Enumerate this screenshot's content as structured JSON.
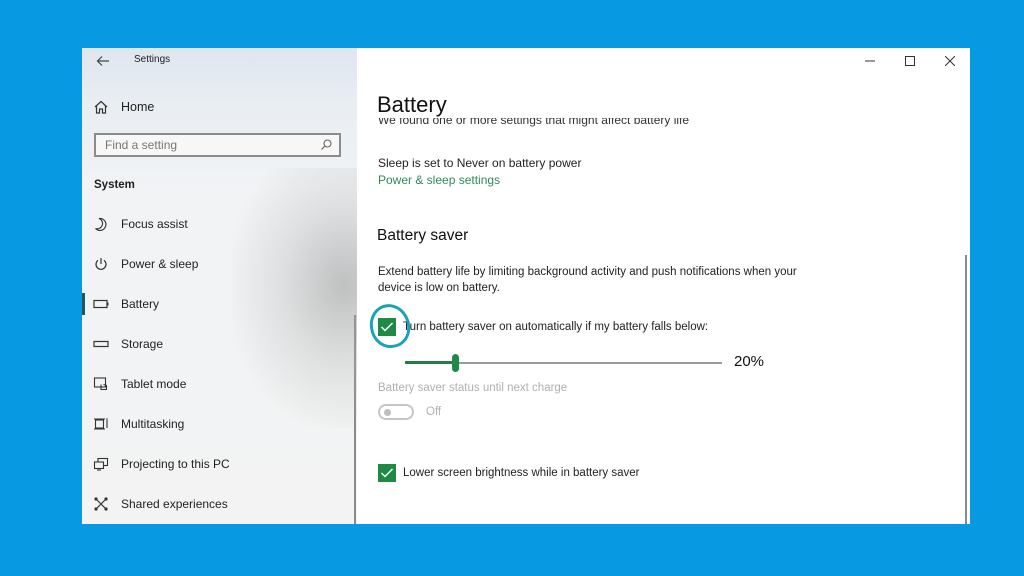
{
  "window": {
    "title": "Settings",
    "controls": {
      "minimize": "minimize",
      "maximize": "maximize",
      "close": "close"
    }
  },
  "sidebar": {
    "home_label": "Home",
    "search_placeholder": "Find a setting",
    "section_title": "System",
    "items": [
      {
        "label": "Focus assist",
        "icon": "moon-icon",
        "selected": false
      },
      {
        "label": "Power & sleep",
        "icon": "power-icon",
        "selected": false
      },
      {
        "label": "Battery",
        "icon": "battery-icon",
        "selected": true
      },
      {
        "label": "Storage",
        "icon": "storage-icon",
        "selected": false
      },
      {
        "label": "Tablet mode",
        "icon": "tablet-mode-icon",
        "selected": false
      },
      {
        "label": "Multitasking",
        "icon": "multitasking-icon",
        "selected": false
      },
      {
        "label": "Projecting to this PC",
        "icon": "projecting-icon",
        "selected": false
      },
      {
        "label": "Shared experiences",
        "icon": "shared-experiences-icon",
        "selected": false
      }
    ]
  },
  "main": {
    "page_title": "Battery",
    "partial_notice": "We found one or more settings that might affect battery life",
    "sleep_notice": "Sleep is set to Never on battery power",
    "power_sleep_link": "Power & sleep settings",
    "battery_saver": {
      "heading": "Battery saver",
      "description": "Extend battery life by limiting background activity and push notifications when your device is low on battery.",
      "auto_checkbox": {
        "label": "Turn battery saver on automatically if my battery falls below:",
        "checked": true
      },
      "threshold_slider": {
        "value": 20,
        "min": 5,
        "max": 100,
        "display": "20%"
      },
      "status_label": "Battery saver status until next charge",
      "status_toggle": {
        "state": "Off",
        "on": false,
        "enabled": false
      },
      "brightness_checkbox": {
        "label": "Lower screen brightness while in battery saver",
        "checked": true
      }
    }
  },
  "colors": {
    "background": "#0899e3",
    "accent_green": "#1f8a45",
    "link_green": "#2e8b57",
    "annotation": "#1aa2b8"
  }
}
